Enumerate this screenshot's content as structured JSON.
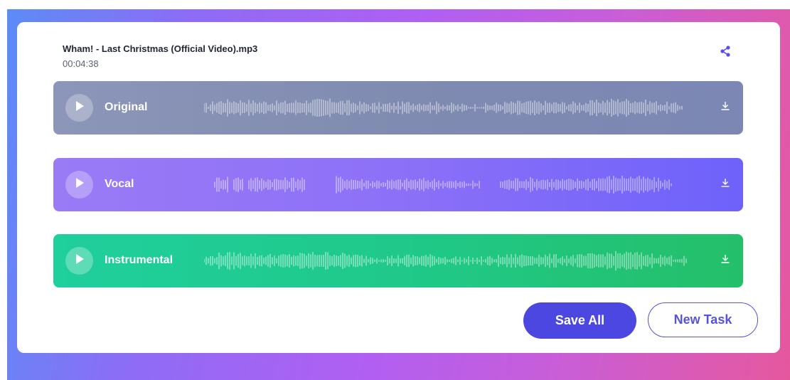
{
  "file": {
    "title": "Wham! - Last Christmas (Official Video).mp3",
    "duration": "00:04:38"
  },
  "tracks": [
    {
      "label": "Original"
    },
    {
      "label": "Vocal"
    },
    {
      "label": "Instrumental"
    }
  ],
  "actions": {
    "save_all_label": "Save All",
    "new_task_label": "New Task"
  },
  "icons": {
    "share": "share-icon",
    "play": "play-icon",
    "download": "download-icon"
  },
  "colors": {
    "accent": "#4b47e0",
    "original_track": "#8290b4",
    "vocal_track": "#8570f8",
    "instrumental_track": "#21c682"
  }
}
